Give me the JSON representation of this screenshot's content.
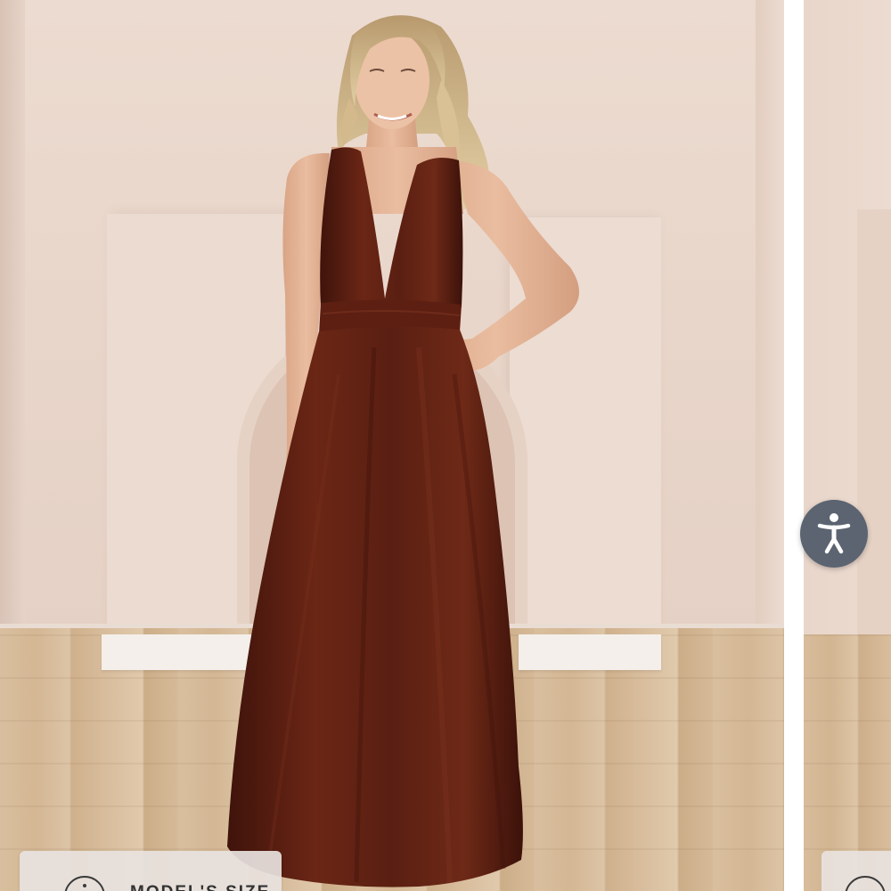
{
  "product_gallery": {
    "model_size_label": "MODEL'S SIZE",
    "dress_color": "#5a1d12",
    "accent_color": "#5b6470"
  },
  "accessibility": {
    "icon": "accessibility-person-icon"
  }
}
